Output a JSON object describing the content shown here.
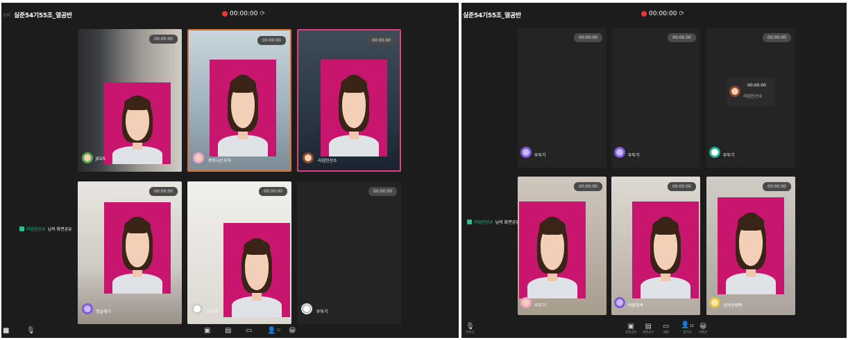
{
  "left": {
    "side_label": "공지",
    "title": "실준54기55조_열공반",
    "timer": "00:00:00",
    "share_note": {
      "name": "라임민선수",
      "text": "님의 화면공유"
    },
    "tiles": [
      {
        "time": "00:00:00",
        "name": "JEUS"
      },
      {
        "time": "00:00:00",
        "name": "중파시간부자"
      },
      {
        "time": "00:00:00",
        "name": "라임민선수"
      },
      {
        "time": "00:00:00",
        "name": "햇살헤기"
      },
      {
        "time": "00:00:00",
        "name": "조우라"
      },
      {
        "time": "00:00:00",
        "name": "뚜뚜기"
      }
    ],
    "participant_count": "12"
  },
  "right": {
    "title": "실준54기55조_열공반",
    "timer": "00:00:00",
    "share_note": {
      "name": "라임민선수",
      "text": "님의 화면공유"
    },
    "top_tiles": [
      {
        "time": "00:00:00",
        "name": "뚜뚜기"
      },
      {
        "time": "00:00:00",
        "name": "뚜뚜기"
      },
      {
        "time": "00:00:00",
        "name": "뚜뚜기"
      }
    ],
    "floating": {
      "time": "00:00:00",
      "name": "라임민선수"
    },
    "bottom_tiles": [
      {
        "time": "00:00:00",
        "name": "뚜뚜기"
      },
      {
        "time": "00:00:00",
        "name": "바람빛박"
      },
      {
        "time": "00:00:00",
        "name": "엄마손패쩍"
      }
    ],
    "mic_label": "마이크",
    "bar": {
      "screen_share": "화면공유",
      "share_view": "화면공유",
      "chat": "채팅",
      "participants": "참가자",
      "participant_count": "12",
      "reaction": "리액션"
    }
  },
  "colors": {
    "accent_orange": "#d8733b",
    "accent_pink": "#e0407c",
    "share_green": "#27c28b",
    "rec_red": "#e53935"
  },
  "icons": [
    "mic-icon",
    "camera-icon",
    "screen-share-icon",
    "chat-icon",
    "person-icon",
    "emoji-icon",
    "refresh-icon"
  ]
}
